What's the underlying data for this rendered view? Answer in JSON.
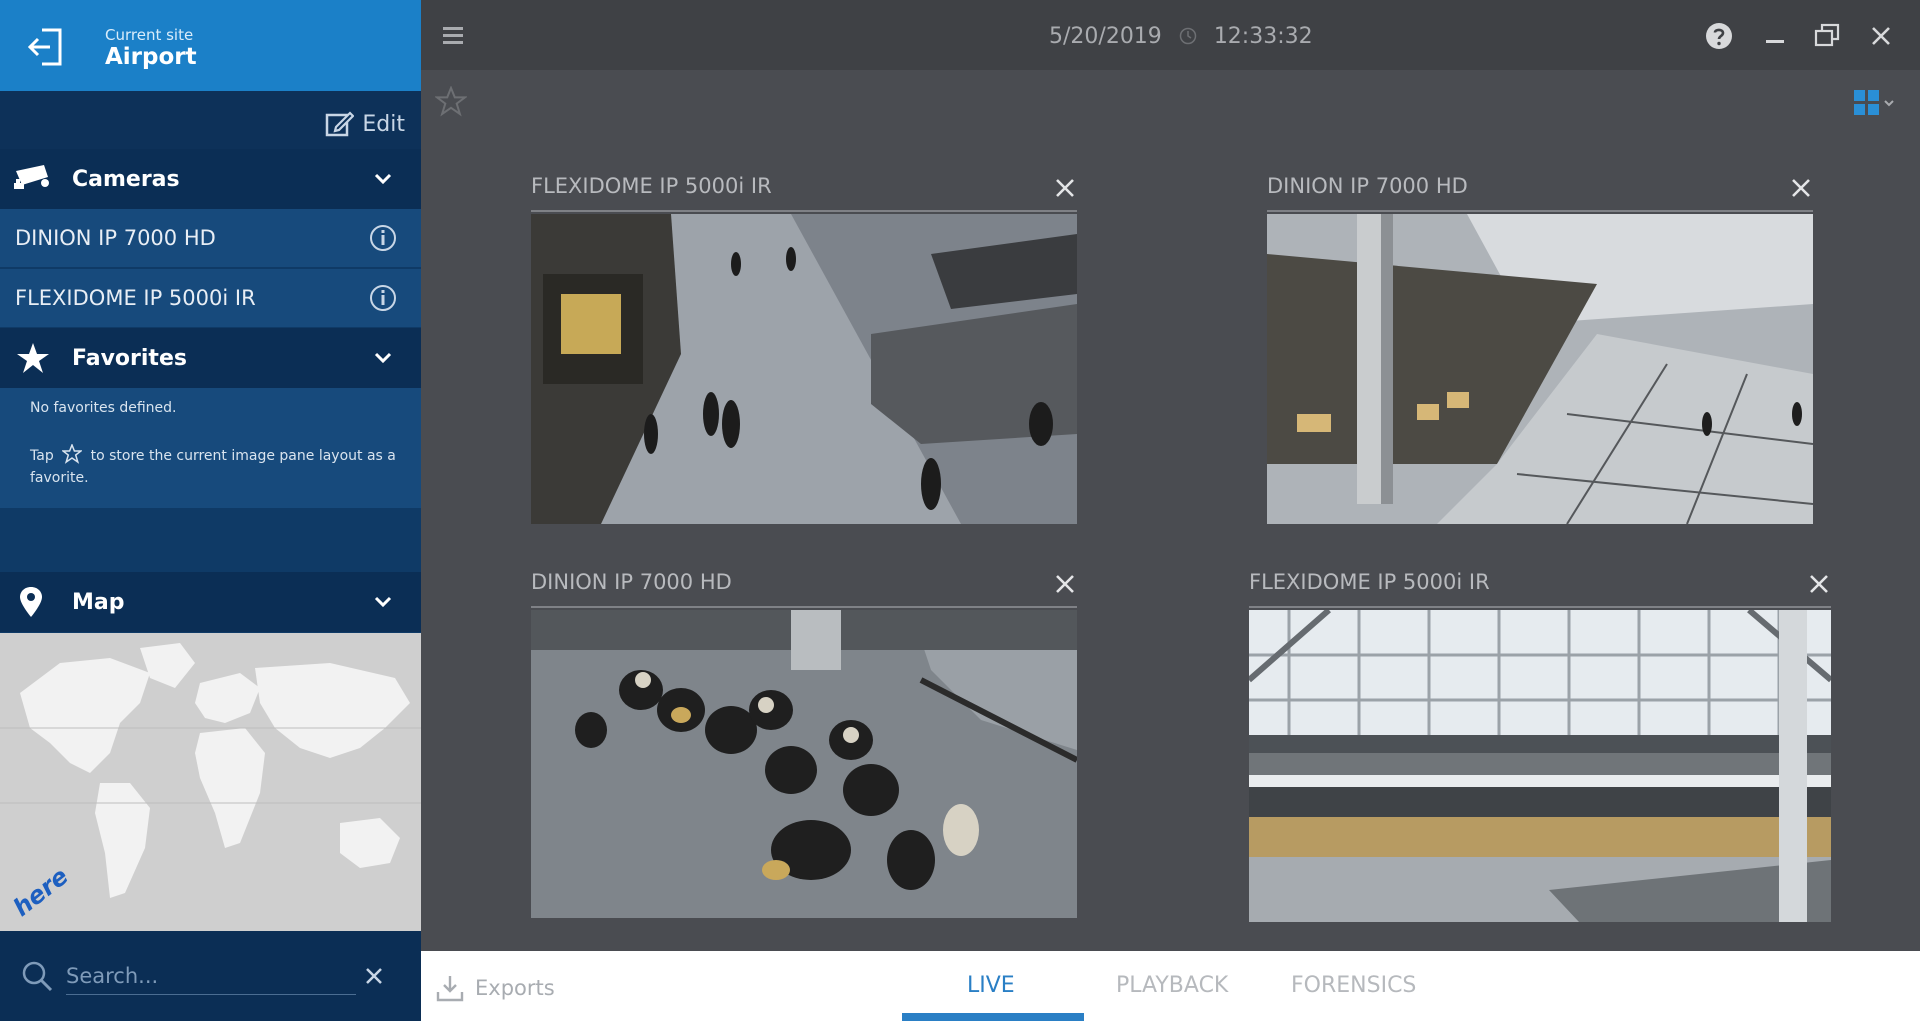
{
  "site": {
    "caption": "Current site",
    "name": "Airport"
  },
  "edit": {
    "label": "Edit"
  },
  "sections": {
    "cameras": {
      "label": "Cameras"
    },
    "favorites": {
      "label": "Favorites",
      "empty_text": "No favorites defined.",
      "hint_prefix": "Tap",
      "hint_suffix": "to store the current image pane layout as a favorite."
    },
    "map": {
      "label": "Map",
      "provider_logo": "here"
    }
  },
  "camera_list": [
    {
      "label": "DINION IP 7000 HD"
    },
    {
      "label": "FLEXIDOME IP 5000i IR"
    }
  ],
  "search": {
    "placeholder": "Search..."
  },
  "topbar": {
    "date": "5/20/2019",
    "time": "12:33:32"
  },
  "panes": [
    {
      "title": "FLEXIDOME IP 5000i IR",
      "scene": "concourse"
    },
    {
      "title": "DINION IP 7000 HD",
      "scene": "checkin-hall"
    },
    {
      "title": "DINION IP 7000 HD",
      "scene": "waiting-area"
    },
    {
      "title": "FLEXIDOME IP 5000i IR",
      "scene": "glass-hall"
    }
  ],
  "bottombar": {
    "exports_label": "Exports",
    "tabs": [
      {
        "label": "LIVE",
        "active": true
      },
      {
        "label": "PLAYBACK",
        "active": false
      },
      {
        "label": "FORENSICS",
        "active": false
      }
    ]
  },
  "colors": {
    "sidebar_bg": "#0f3a66",
    "site_header": "#1b80c8",
    "accent": "#2a7fc5",
    "main_bg": "#4a4c51"
  }
}
